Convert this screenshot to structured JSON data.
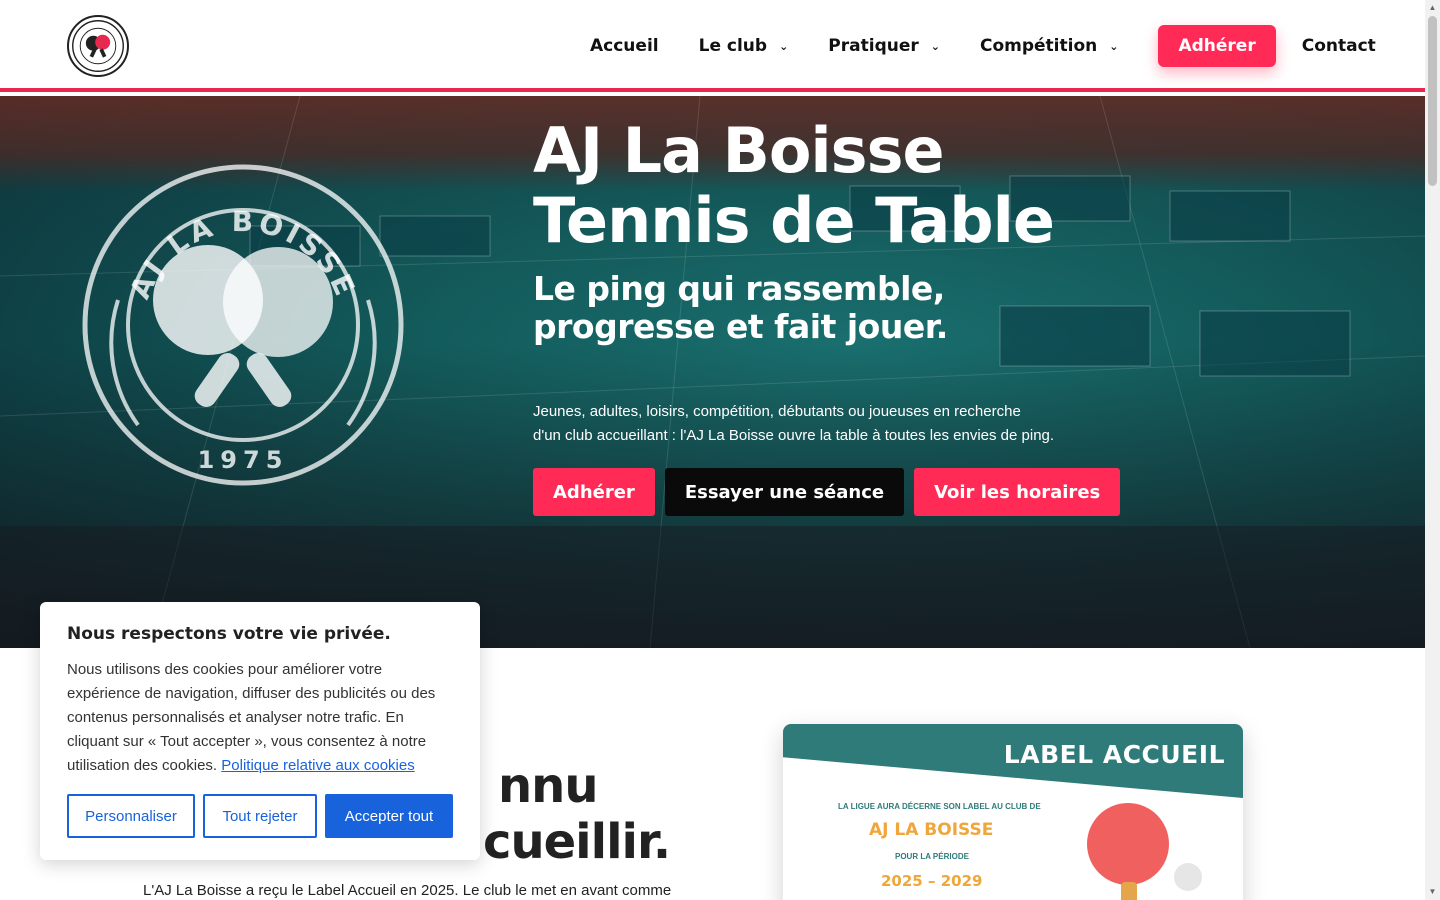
{
  "header": {
    "logo_alt": "AJ La Boisse",
    "nav": [
      {
        "label": "Accueil",
        "has_dropdown": false
      },
      {
        "label": "Le club",
        "has_dropdown": true
      },
      {
        "label": "Pratiquer",
        "has_dropdown": true
      },
      {
        "label": "Compétition",
        "has_dropdown": true
      }
    ],
    "cta_label": "Adhérer",
    "contact_label": "Contact"
  },
  "hero": {
    "title_line1": "AJ La Boisse",
    "title_line2": "Tennis de Table",
    "subtitle_line1": "Le ping qui rassemble,",
    "subtitle_line2": "progresse et fait jouer.",
    "description_line1": "Jeunes, adultes, loisirs, compétition, débutants ou joueuses en recherche",
    "description_line2": "d'un club accueillant : l'AJ La Boisse ouvre la table à toutes les envies de ping.",
    "buttons": {
      "join": "Adhérer",
      "try": "Essayer une séance",
      "schedule": "Voir les horaires"
    },
    "emblem_text": "AJ LA BOISSE",
    "emblem_year": "1975"
  },
  "section": {
    "heading_line1": "nnu",
    "heading_line2": "cueillir.",
    "text": "L'AJ La Boisse a reçu le Label Accueil en 2025. Le club le met en avant comme"
  },
  "label_card": {
    "title": "LABEL ACCUEIL",
    "line1": "LA LIGUE AURA DÉCERNE SON LABEL AU CLUB DE",
    "club": "AJ LA BOISSE",
    "period_label": "POUR LA PÉRIODE",
    "period": "2025 – 2029"
  },
  "cookie_banner": {
    "title": "Nous respectons votre vie privée.",
    "text": "Nous utilisons des cookies pour améliorer votre expérience de navigation, diffuser des publicités ou des contenus personnalisés et analyser notre trafic. En cliquant sur « Tout accepter », vous consentez à notre utilisation des cookies.",
    "link": "Politique relative aux cookies",
    "customize": "Personnaliser",
    "reject": "Tout rejeter",
    "accept": "Accepter tout"
  },
  "colors": {
    "accent": "#ff2b56",
    "header_border": "#e8294f",
    "cookie_blue": "#1863dc",
    "label_teal": "#2f7b79",
    "label_orange": "#f0a63a"
  },
  "icons": {
    "dropdown": "chevron-down-icon",
    "logo": "paddles-logo-icon"
  }
}
